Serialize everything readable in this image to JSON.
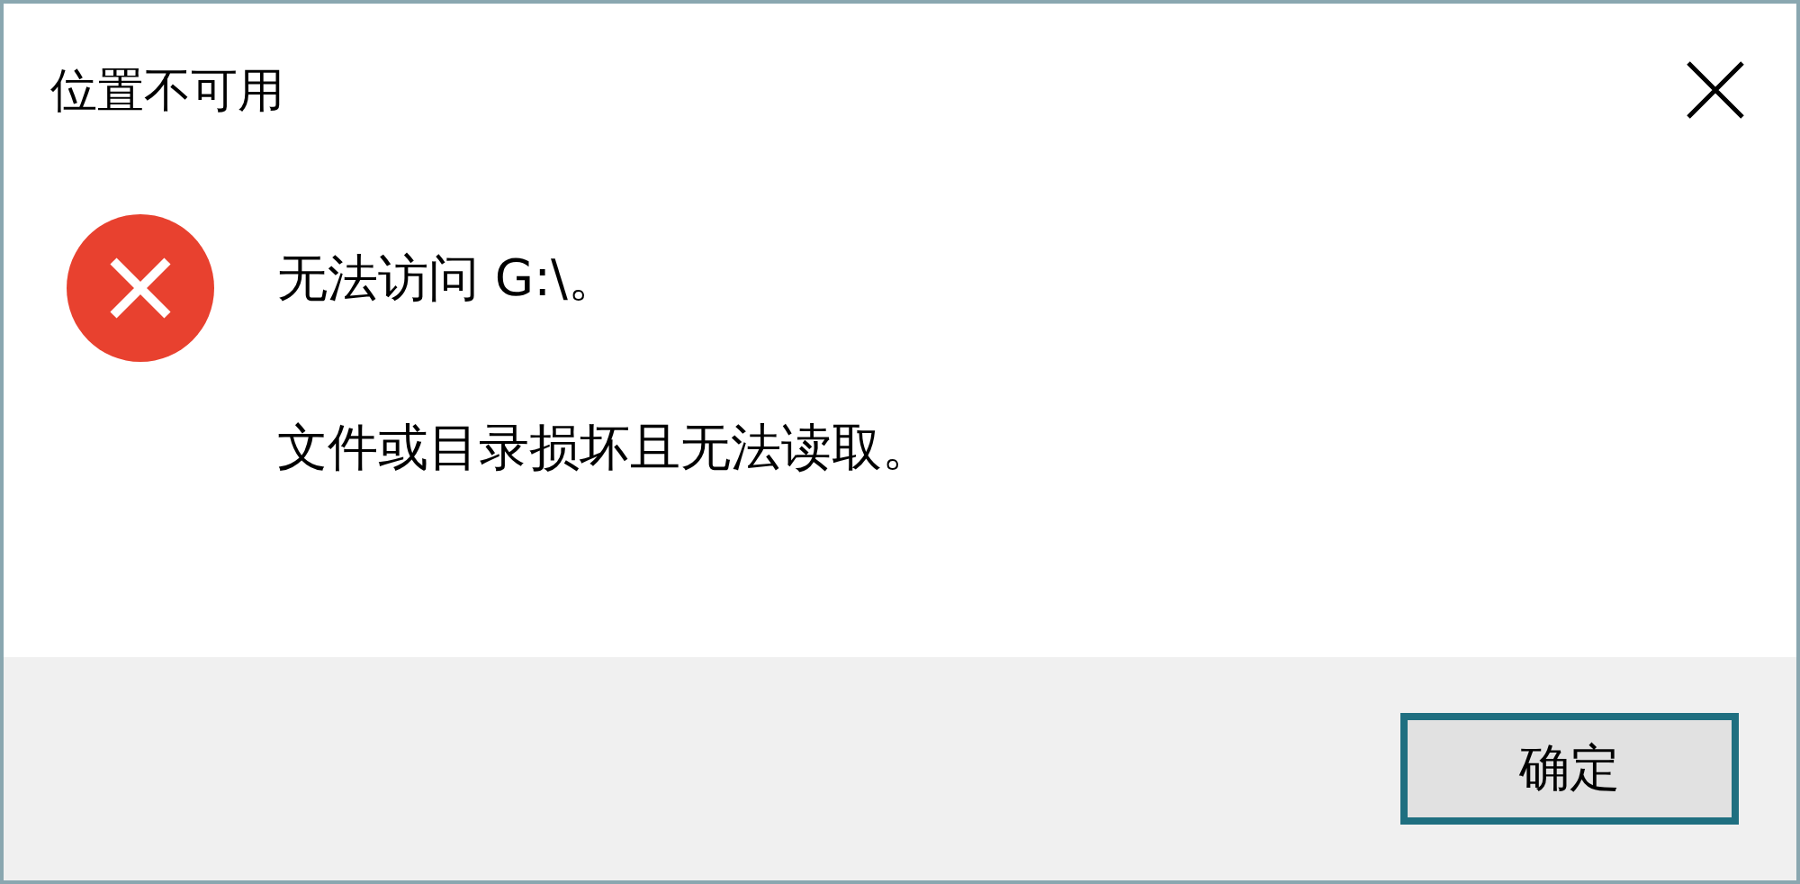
{
  "window": {
    "title": "位置不可用"
  },
  "message": {
    "lines": [
      "无法访问 G:\\。",
      "文件或目录损坏且无法读取。"
    ]
  },
  "buttons": [
    {
      "label": "确定",
      "selected": true
    }
  ]
}
